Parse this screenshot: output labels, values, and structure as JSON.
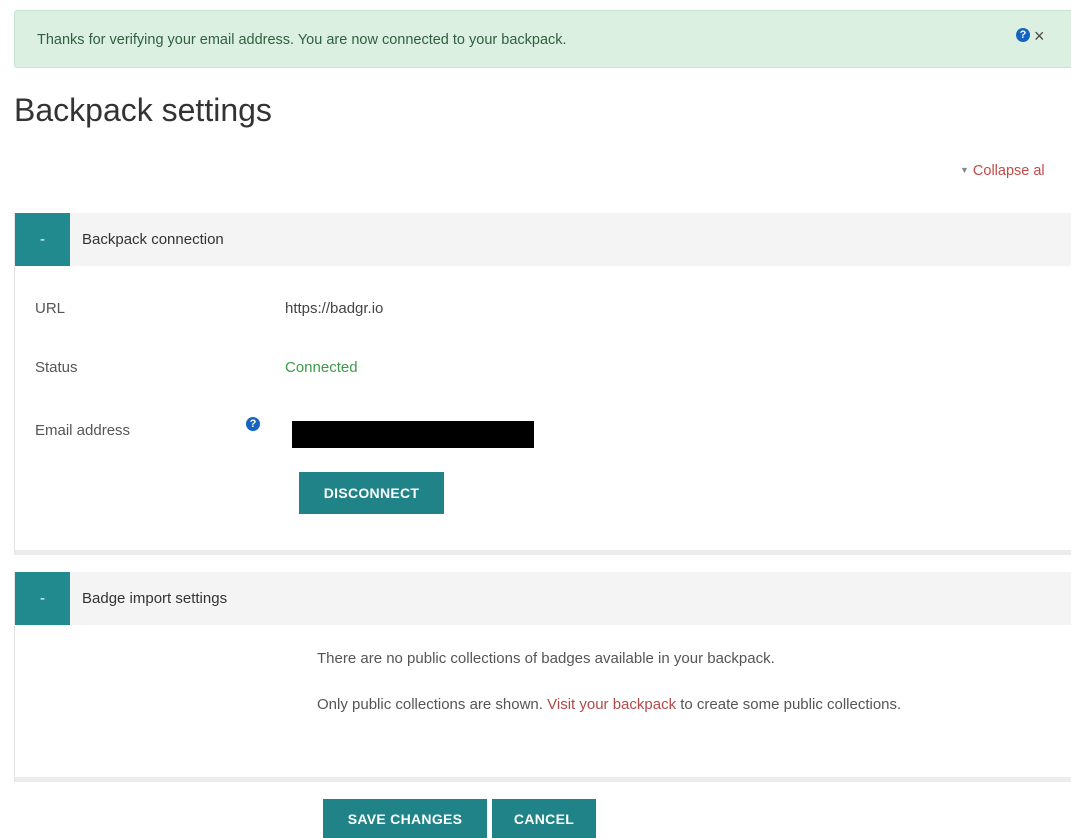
{
  "alert": {
    "message": "Thanks for verifying your email address. You are now connected to your backpack.",
    "help_icon_glyph": "?",
    "close_icon_glyph": "×"
  },
  "page": {
    "title": "Backpack settings",
    "collapse_all_label": "Collapse al",
    "collapse_icon_glyph": "▼"
  },
  "backpack_connection": {
    "toggle_symbol": "-",
    "legend": "Backpack connection",
    "url_label": "URL",
    "url_value": "https://badgr.io",
    "status_label": "Status",
    "status_value": "Connected",
    "email_label": "Email address",
    "email_help_glyph": "?",
    "disconnect_label": "DISCONNECT"
  },
  "badge_import": {
    "toggle_symbol": "-",
    "legend": "Badge import settings",
    "no_collections_text": "There are no public collections of badges available in your backpack.",
    "info_prefix": "Only public collections are shown. ",
    "info_link": "Visit your backpack",
    "info_suffix": " to create some public collections."
  },
  "actions": {
    "save_label": "SAVE CHANGES",
    "cancel_label": "CANCEL"
  },
  "colors": {
    "accent": "#218a8e",
    "alert_bg": "#dcf0e2",
    "status_connected": "#3c9a4a",
    "link": "#b2484a",
    "help_icon": "#1565c0"
  }
}
